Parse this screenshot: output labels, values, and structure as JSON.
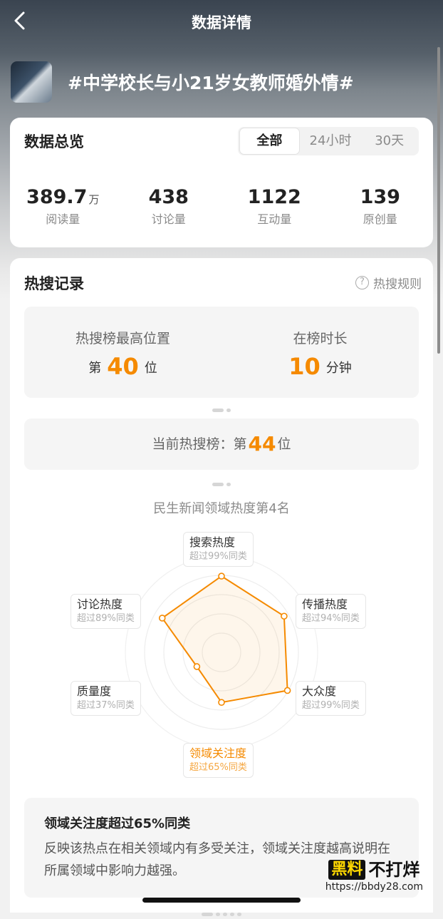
{
  "header": {
    "title": "数据详情"
  },
  "topic": {
    "title": "#中学校长与小21岁女教师婚外情#"
  },
  "overview": {
    "title": "数据总览",
    "tabs": [
      "全部",
      "24小时",
      "30天"
    ],
    "active_tab": 0,
    "stats": [
      {
        "value": "389.7",
        "unit": "万",
        "label": "阅读量"
      },
      {
        "value": "438",
        "unit": "",
        "label": "讨论量"
      },
      {
        "value": "1122",
        "unit": "",
        "label": "互动量"
      },
      {
        "value": "139",
        "unit": "",
        "label": "原创量"
      }
    ]
  },
  "hot": {
    "title": "热搜记录",
    "rules_label": "热搜规则",
    "rules_icon": "question-icon",
    "peak_label": "热搜榜最高位置",
    "peak_prefix": "第",
    "peak_value": "40",
    "peak_suffix": "位",
    "duration_label": "在榜时长",
    "duration_value": "10",
    "duration_unit": "分钟",
    "current_prefix": "当前热搜榜：第",
    "current_value": "44",
    "current_suffix": "位"
  },
  "radar": {
    "title": "民生新闻领域热度第4名",
    "accent": "#f58a00",
    "metrics": [
      {
        "name": "搜索热度",
        "sub": "超过99%同类",
        "value": 0.99
      },
      {
        "name": "传播热度",
        "sub": "超过94%同类",
        "value": 0.94
      },
      {
        "name": "大众度",
        "sub": "超过99%同类",
        "value": 0.99
      },
      {
        "name": "领域关注度",
        "sub": "超过65%同类",
        "value": 0.65,
        "highlight": true
      },
      {
        "name": "质量度",
        "sub": "超过37%同类",
        "value": 0.37
      },
      {
        "name": "讨论热度",
        "sub": "超过89%同类",
        "value": 0.89
      }
    ]
  },
  "description": {
    "title": "领域关注度超过65%同类",
    "text": "反映该热点在相关领域内有多受关注，领域关注度越高说明在所属领域中影响力越强。"
  },
  "watermark": {
    "logo_black": "黑料",
    "logo_rest": "不打烊",
    "url": "https://bbdy28.com"
  }
}
